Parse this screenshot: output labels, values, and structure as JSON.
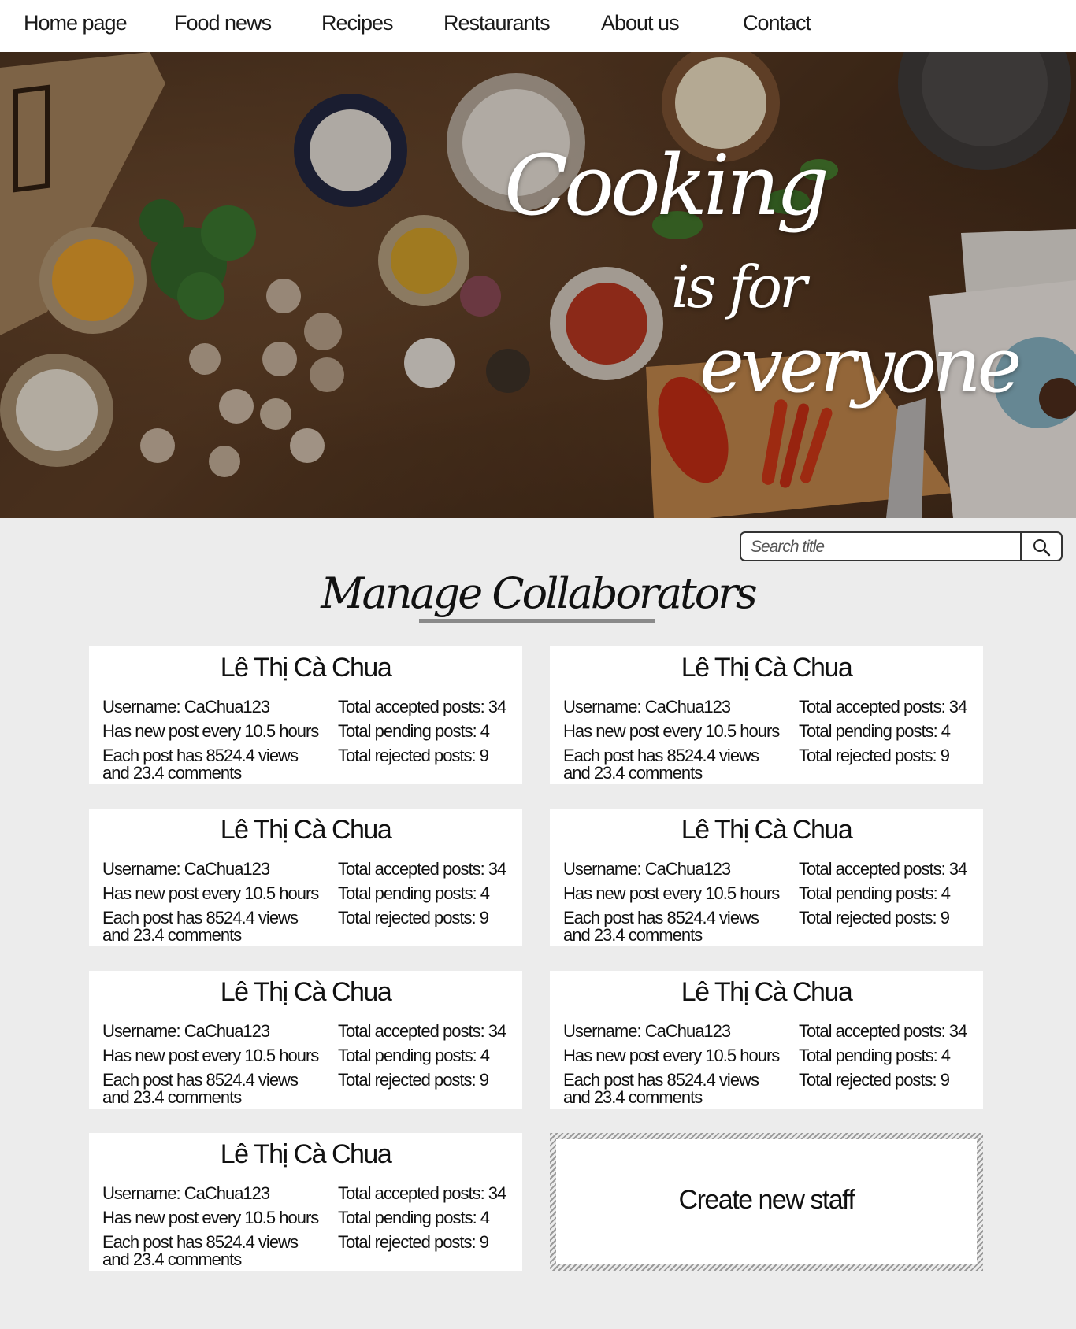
{
  "nav": {
    "items": [
      {
        "label": "Home page"
      },
      {
        "label": "Food news"
      },
      {
        "label": "Recipes"
      },
      {
        "label": "Restaurants"
      },
      {
        "label": "About us"
      },
      {
        "label": "Contact"
      }
    ]
  },
  "hero": {
    "line1": "Cooking",
    "line2": "is for",
    "line3": "everyone"
  },
  "search": {
    "placeholder": "Search title",
    "icon": "search-icon"
  },
  "page_title": "Manage Collaborators",
  "collaborators": [
    {
      "name": "Lê Thị Cà Chua",
      "username": "Username: CaChua123",
      "frequency": "Has new post every 10.5 hours",
      "stats_line1": "Each post has 8524.4 views",
      "stats_line2": "and 23.4 comments",
      "accepted": "Total accepted posts: 34",
      "pending": "Total pending posts: 4",
      "rejected": "Total rejected posts: 9"
    },
    {
      "name": "Lê Thị Cà Chua",
      "username": "Username: CaChua123",
      "frequency": "Has new post every 10.5 hours",
      "stats_line1": "Each post has 8524.4 views",
      "stats_line2": "and 23.4 comments",
      "accepted": "Total accepted posts: 34",
      "pending": "Total pending posts: 4",
      "rejected": "Total rejected posts: 9"
    },
    {
      "name": "Lê Thị Cà Chua",
      "username": "Username: CaChua123",
      "frequency": "Has new post every 10.5 hours",
      "stats_line1": "Each post has 8524.4 views",
      "stats_line2": "and 23.4 comments",
      "accepted": "Total accepted posts: 34",
      "pending": "Total pending posts: 4",
      "rejected": "Total rejected posts: 9"
    },
    {
      "name": "Lê Thị Cà Chua",
      "username": "Username: CaChua123",
      "frequency": "Has new post every 10.5 hours",
      "stats_line1": "Each post has 8524.4 views",
      "stats_line2": "and 23.4 comments",
      "accepted": "Total accepted posts: 34",
      "pending": "Total pending posts: 4",
      "rejected": "Total rejected posts: 9"
    },
    {
      "name": "Lê Thị Cà Chua",
      "username": "Username: CaChua123",
      "frequency": "Has new post every 10.5 hours",
      "stats_line1": "Each post has 8524.4 views",
      "stats_line2": "and 23.4 comments",
      "accepted": "Total accepted posts: 34",
      "pending": "Total pending posts: 4",
      "rejected": "Total rejected posts: 9"
    },
    {
      "name": "Lê Thị Cà Chua",
      "username": "Username: CaChua123",
      "frequency": "Has new post every 10.5 hours",
      "stats_line1": "Each post has 8524.4 views",
      "stats_line2": "and 23.4 comments",
      "accepted": "Total accepted posts: 34",
      "pending": "Total pending posts: 4",
      "rejected": "Total rejected posts: 9"
    },
    {
      "name": "Lê Thị Cà Chua",
      "username": "Username: CaChua123",
      "frequency": "Has new post every 10.5 hours",
      "stats_line1": "Each post has 8524.4 views",
      "stats_line2": "and 23.4 comments",
      "accepted": "Total accepted posts: 34",
      "pending": "Total pending posts: 4",
      "rejected": "Total rejected posts: 9"
    }
  ],
  "create_staff": {
    "label": "Create new staff"
  }
}
